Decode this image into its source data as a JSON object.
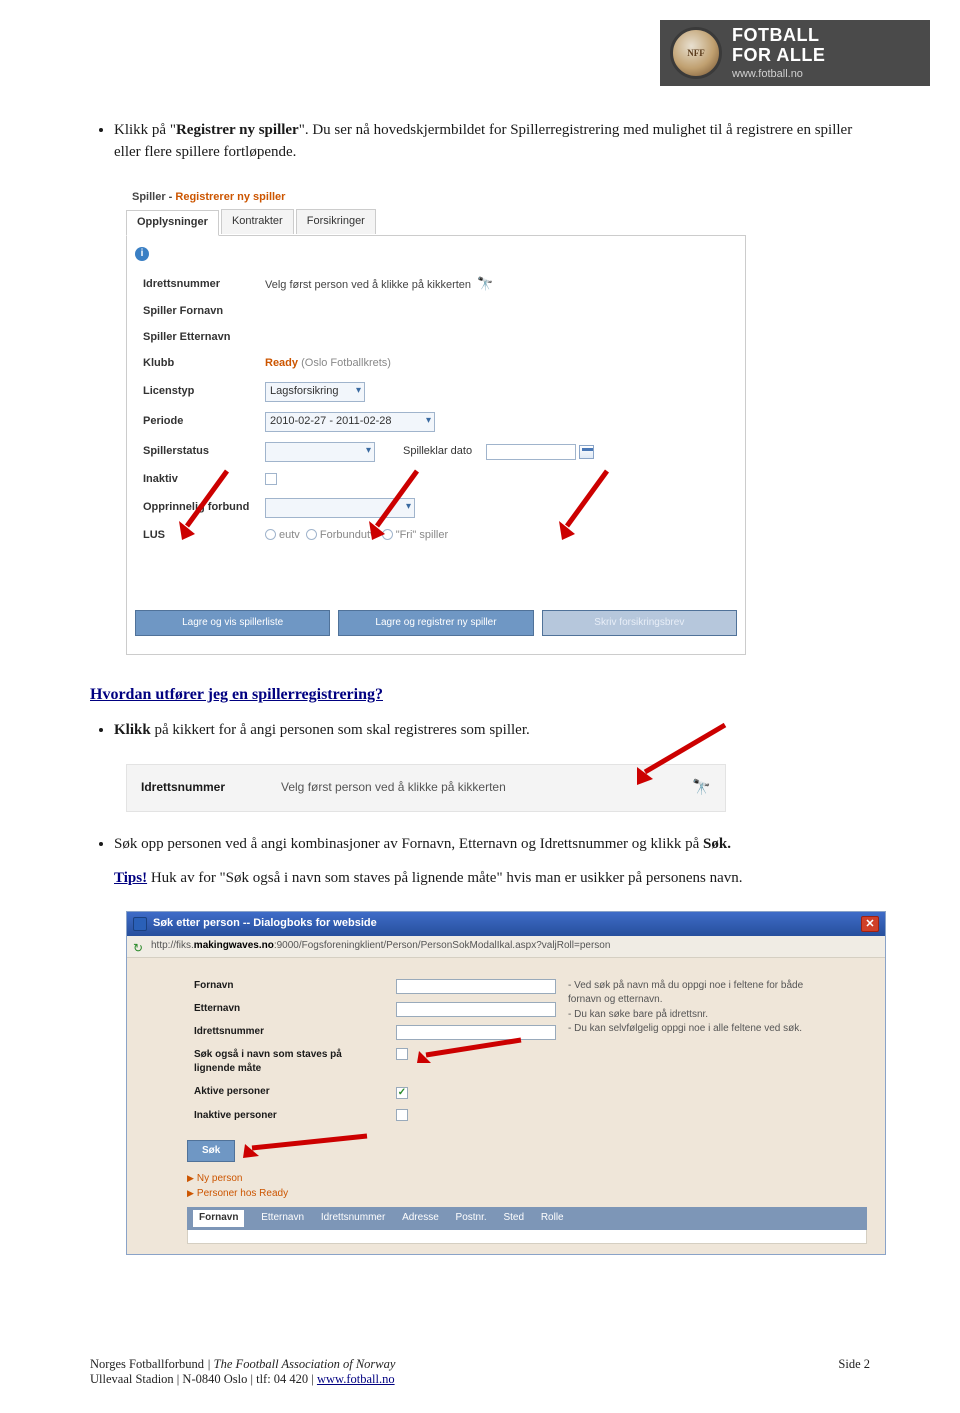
{
  "banner": {
    "line1": "FOTBALL",
    "line2": "FOR ALLE",
    "url": "www.fotball.no"
  },
  "para1": {
    "pre": "Klikk på \"",
    "bold": "Registrer ny spiller",
    "post": "\". Du ser nå hovedskjermbildet for Spillerregistrering med mulighet til å registrere en spiller eller flere spillere fortløpende."
  },
  "shot1": {
    "title_a": "Spiller - ",
    "title_b": "Registrerer ny spiller",
    "tabs": [
      "Opplysninger",
      "Kontrakter",
      "Forsikringer"
    ],
    "rows": {
      "idretts_label": "Idrettsnummer",
      "idretts_hint": "Velg først person ved å klikke på kikkerten",
      "fornavn": "Spiller Fornavn",
      "etternavn": "Spiller Etternavn",
      "klubb_label": "Klubb",
      "klubb_value": "Ready",
      "klubb_grey": "(Oslo Fotballkrets)",
      "licenstyp_label": "Licenstyp",
      "licenstyp_value": "Lagsforsikring",
      "periode_label": "Periode",
      "periode_value": "2010-02-27 - 2011-02-28",
      "status_label": "Spillerstatus",
      "klar_label": "Spilleklar dato",
      "inaktiv_label": "Inaktiv",
      "forbund_label": "Opprinnelig forbund",
      "lus_label": "LUS",
      "radio_b": "Forbundutv",
      "radio_c": "\"Fri\" spiller"
    },
    "buttons": {
      "a": "Lagre og vis spillerliste",
      "b": "Lagre og registrer ny spiller",
      "c": "Skriv forsikringsbrev"
    }
  },
  "heading2": "Hvordan utfører jeg en spillerregistrering?",
  "para2": {
    "bold": "Klikk",
    "rest": " på kikkert for å angi personen som skal registreres som spiller."
  },
  "shot2": {
    "label": "Idrettsnummer",
    "hint": "Velg først person ved å klikke på kikkerten"
  },
  "para3": {
    "pre": "Søk opp personen ved å angi kombinasjoner av Fornavn, Etternavn og Idrettsnummer og klikk på ",
    "bold": "Søk.",
    "post": ""
  },
  "para4": {
    "tips": "Tips!",
    "rest": " Huk av for \"Søk også i navn som staves på lignende måte\" hvis man er usikker på personens navn."
  },
  "shot3": {
    "title": "Søk etter person -- Dialogboks for webside",
    "url_pre": "http://fiks.",
    "url_bold": "makingwaves.no",
    "url_post": ":9000/Fogsforeningklient/Person/PersonSokModalIkal.aspx?valjRoll=person",
    "fields": {
      "fornavn": "Fornavn",
      "etternavn": "Etternavn",
      "idretts": "Idrettsnummer",
      "lignende": "Søk også i navn som staves på lignende måte",
      "aktive": "Aktive personer",
      "inaktive": "Inaktive personer"
    },
    "hints_a": "- Ved søk på navn må du oppgi noe i feltene for både fornavn og etternavn.",
    "hints_b": "- Du kan søke bare på idrettsnr.",
    "hints_c": "- Du kan selvfølgelig oppgi noe i alle feltene ved søk.",
    "sok": "Søk",
    "links": {
      "ny": "Ny person",
      "hos": "Personer hos Ready"
    },
    "result_cols": [
      "Fornavn",
      "Etternavn",
      "Idrettsnummer",
      "Adresse",
      "Postnr.",
      "Sted",
      "Rolle"
    ]
  },
  "footer": {
    "org": "Norges Fotballforbund",
    "org_italic": " | The Football Association of Norway",
    "addr_a": "Ullevaal Stadion | N-0840 Oslo | tlf: 04 420 | ",
    "link": "www.fotball.no",
    "page": "Side 2"
  }
}
